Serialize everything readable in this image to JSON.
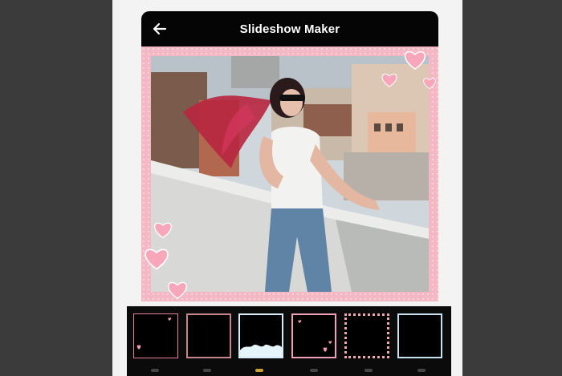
{
  "header": {
    "title": "Slideshow Maker",
    "back_icon": "arrow-left-icon"
  },
  "colors": {
    "header_bg": "#050505",
    "frame_pink": "#f4b8c4",
    "heart_pink": "#f59ab0",
    "page_bg": "#3b3b3b"
  },
  "preview": {
    "frame_style": "pink-hearts"
  },
  "frames": [
    {
      "style": "black-pink-hearts"
    },
    {
      "style": "black-rose-border"
    },
    {
      "style": "black-clouds-blue"
    },
    {
      "style": "black-pink-love"
    },
    {
      "style": "black-pink-stitch"
    },
    {
      "style": "black-light-blue"
    }
  ]
}
